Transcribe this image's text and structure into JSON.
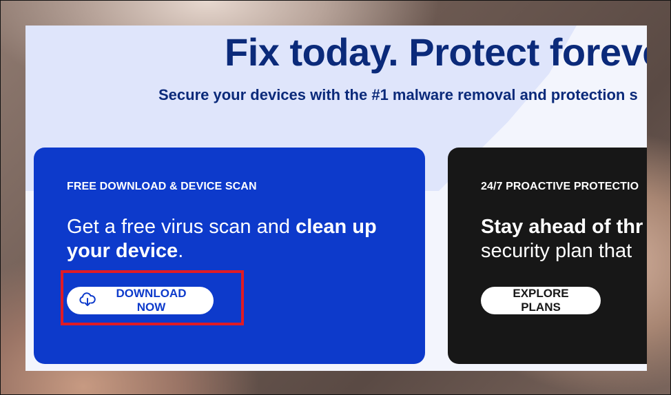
{
  "hero": {
    "headline": "Fix today. Protect forever.",
    "subheadline": "Secure your devices with the #1 malware removal and protection s"
  },
  "cards": [
    {
      "eyebrow": "FREE DOWNLOAD & DEVICE SCAN",
      "lead_regular": "Get a free virus scan and ",
      "lead_bold": "clean up your device",
      "lead_end": ".",
      "button_label": "DOWNLOAD NOW",
      "button_icon": "cloud-download-icon",
      "color": "#0d3acb"
    },
    {
      "eyebrow": "24/7 PROACTIVE PROTECTIO",
      "lead_bold": "Stay ahead of thr",
      "lead_regular": "security plan that",
      "button_label": "EXPLORE PLANS",
      "color": "#171717"
    }
  ],
  "colors": {
    "brand_navy": "#0b2a7a",
    "highlight_red": "#e01b24"
  }
}
